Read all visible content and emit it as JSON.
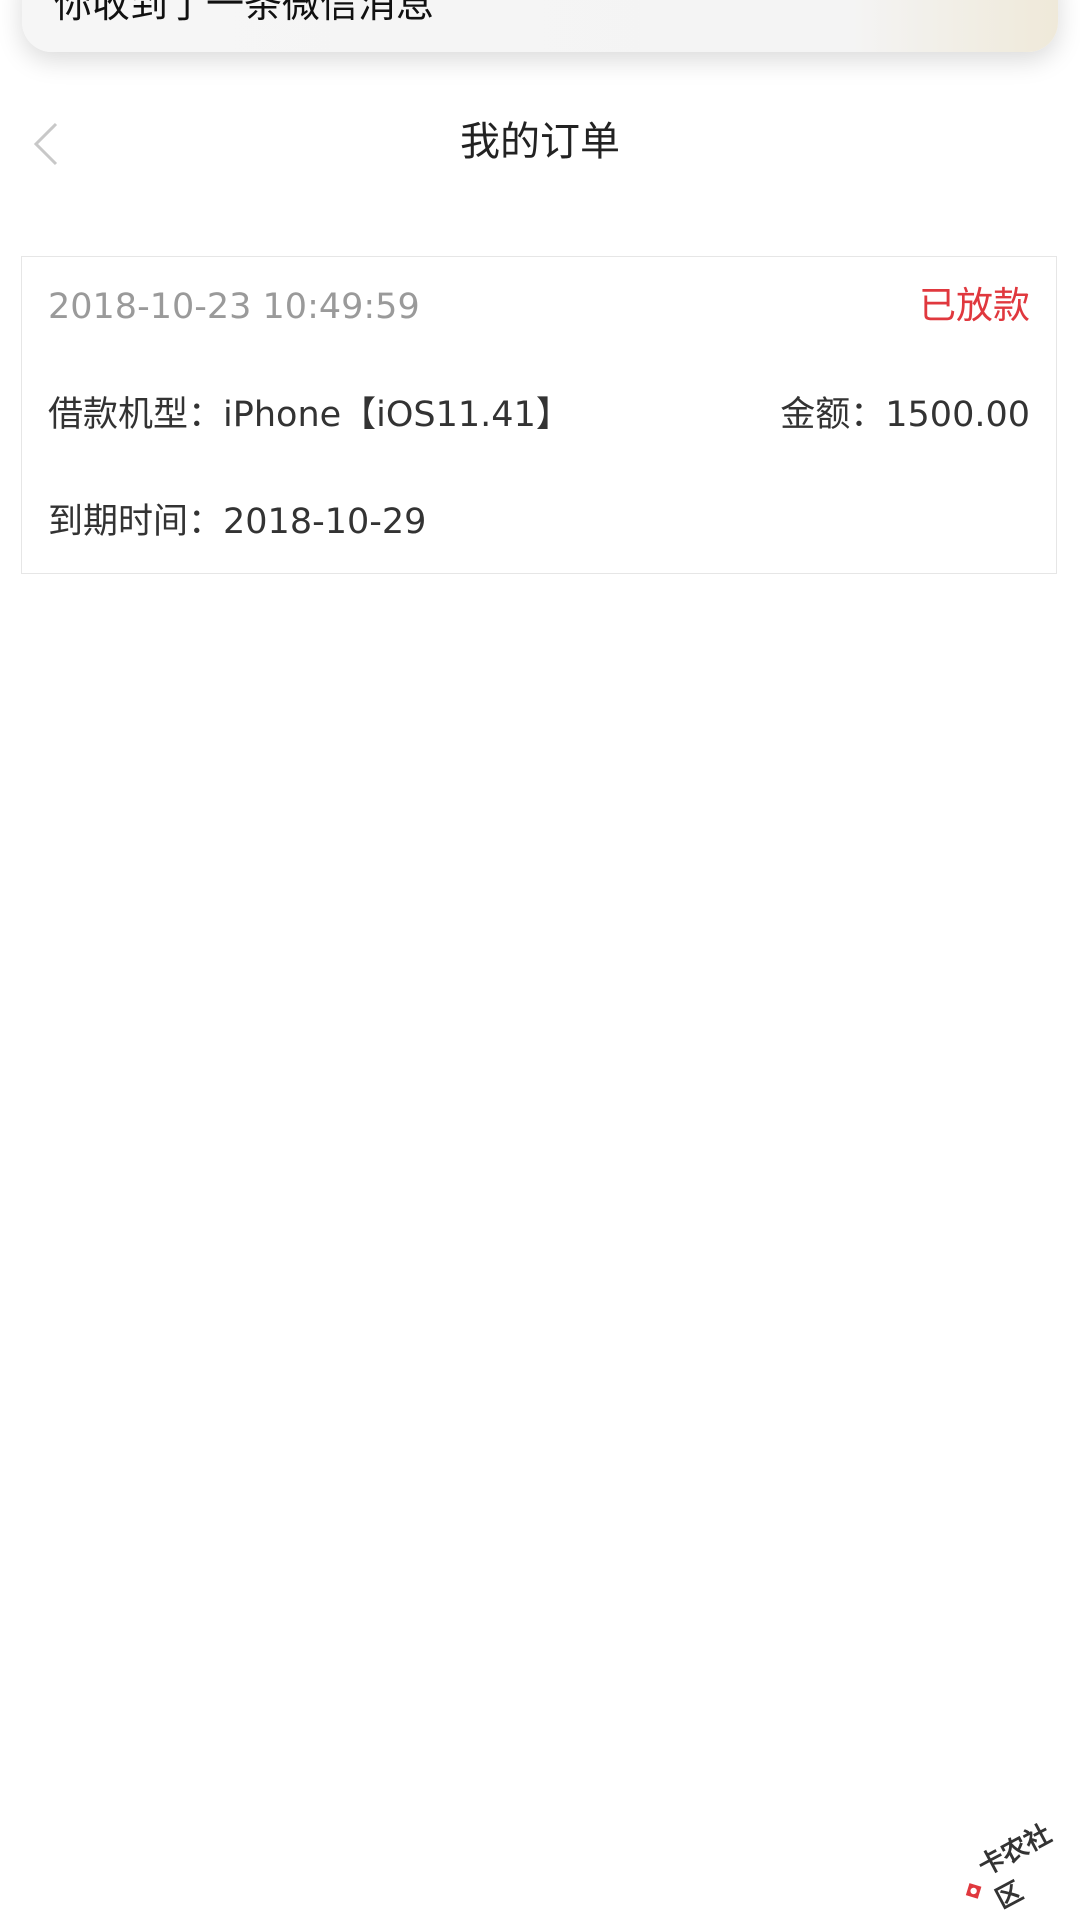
{
  "notification": {
    "text": "你收到了一条微信消息"
  },
  "nav": {
    "title": "我的订单",
    "back_icon": "chevron-left-icon"
  },
  "order": {
    "datetime": "2018-10-23 10:49:59",
    "status": "已放款",
    "device_label": "借款机型：",
    "device_value": "iPhone【iOS11.41】",
    "amount_label": "金额：",
    "amount_value": "1500.00",
    "due_label": "到期时间：",
    "due_value": "2018-10-29"
  },
  "watermark": {
    "text": "卡农社区"
  },
  "colors": {
    "status_red": "#e0383e",
    "muted_gray": "#9a9a9a",
    "text_dark": "#333333"
  }
}
